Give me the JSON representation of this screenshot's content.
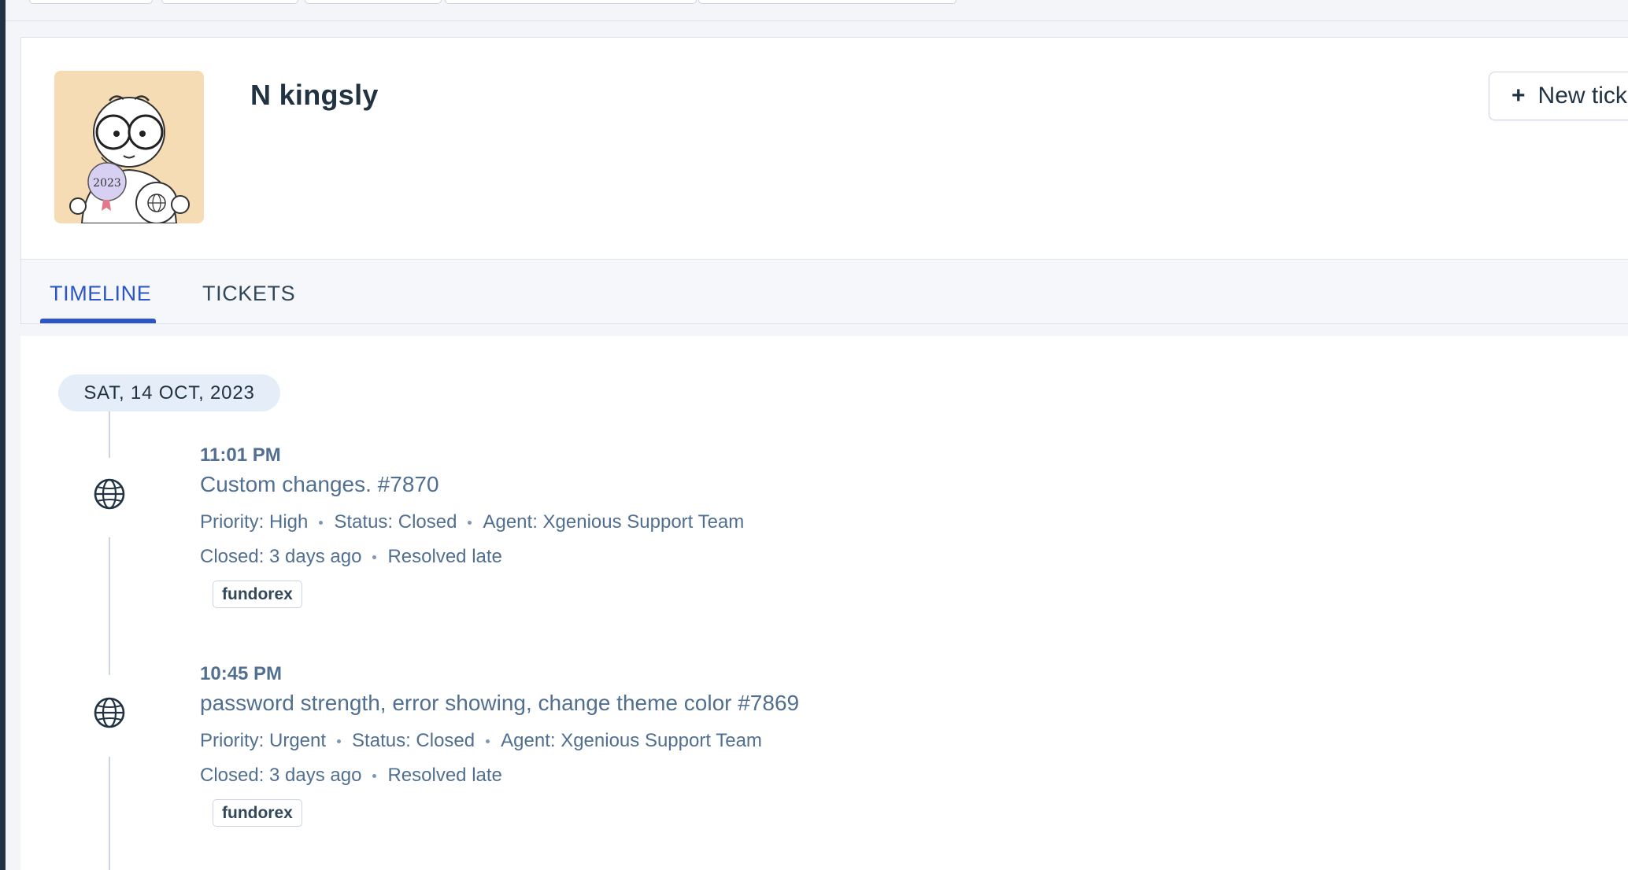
{
  "contact": {
    "name": "N kingsly",
    "avatar_badge_text": "2023"
  },
  "actions": {
    "new_ticket_plus": "+",
    "new_ticket_label": "New tick"
  },
  "tabs": [
    {
      "label": "TIMELINE",
      "active": true
    },
    {
      "label": "TICKETS",
      "active": false
    }
  ],
  "timeline": {
    "date_label": "SAT, 14 OCT, 2023",
    "events": [
      {
        "time": "11:01 PM",
        "title": "Custom changes. #7870",
        "priority": "Priority: High",
        "status": "Status: Closed",
        "agent": "Agent: Xgenious Support Team",
        "closed": "Closed: 3 days ago",
        "resolution": "Resolved late",
        "tag": "fundorex",
        "icon": "globe-icon"
      },
      {
        "time": "10:45 PM",
        "title": "password strength, error showing, change theme color #7869",
        "priority": "Priority: Urgent",
        "status": "Status: Closed",
        "agent": "Agent: Xgenious Support Team",
        "closed": "Closed: 3 days ago",
        "resolution": "Resolved late",
        "tag": "fundorex",
        "icon": "globe-icon"
      }
    ]
  },
  "colors": {
    "accent": "#2c56c8",
    "text_dark": "#213343",
    "text_muted": "#516f90",
    "date_chip_bg": "#e5eef8",
    "avatar_bg": "#f6dcb5"
  }
}
